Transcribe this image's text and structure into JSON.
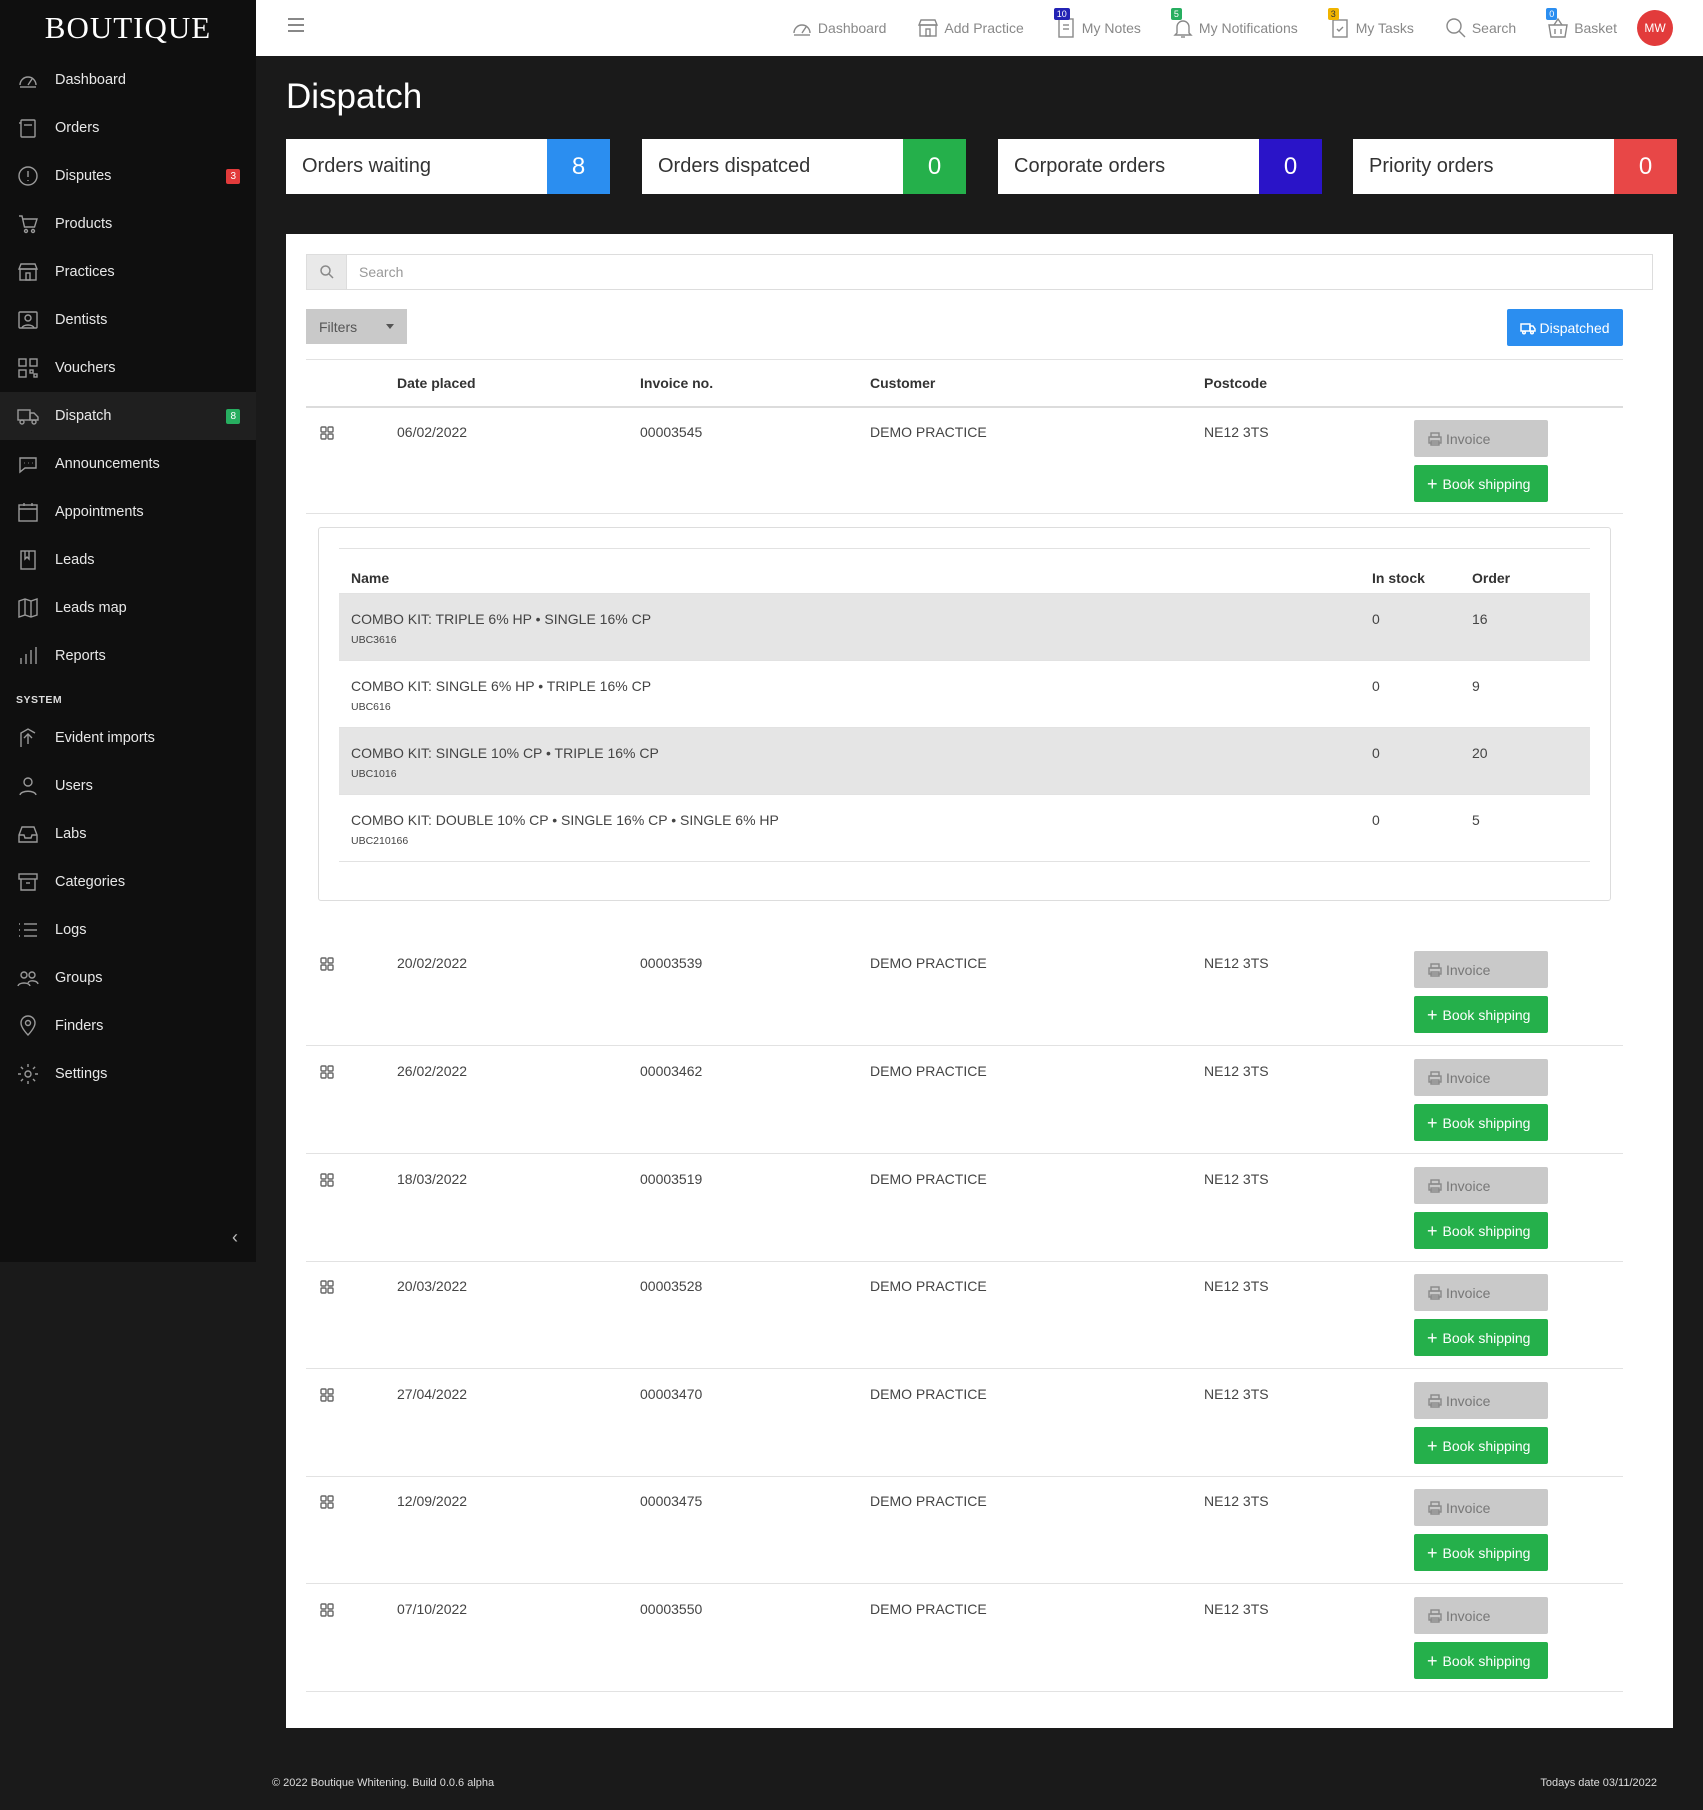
{
  "app": {
    "logo": "BOUTIQUE",
    "page_title": "Dispatch"
  },
  "sidebar": {
    "items": [
      {
        "label": "Dashboard",
        "icon": "dashboard-icon"
      },
      {
        "label": "Orders",
        "icon": "orders-icon"
      },
      {
        "label": "Disputes",
        "icon": "disputes-icon",
        "badge": "3"
      },
      {
        "label": "Products",
        "icon": "cart-icon"
      },
      {
        "label": "Practices",
        "icon": "store-icon"
      },
      {
        "label": "Dentists",
        "icon": "dentist-icon"
      },
      {
        "label": "Vouchers",
        "icon": "qr-icon"
      },
      {
        "label": "Dispatch",
        "icon": "truck-icon",
        "badge": "8",
        "active": true
      },
      {
        "label": "Announcements",
        "icon": "chat-icon"
      },
      {
        "label": "Appointments",
        "icon": "calendar-icon"
      },
      {
        "label": "Leads",
        "icon": "book-icon"
      },
      {
        "label": "Leads map",
        "icon": "map-icon"
      },
      {
        "label": "Reports",
        "icon": "bar-chart-icon"
      }
    ],
    "system_label": "SYSTEM",
    "system_items": [
      {
        "label": "Evident imports",
        "icon": "import-icon"
      },
      {
        "label": "Users",
        "icon": "user-icon"
      },
      {
        "label": "Labs",
        "icon": "inbox-icon"
      },
      {
        "label": "Categories",
        "icon": "archive-icon"
      },
      {
        "label": "Logs",
        "icon": "list-icon"
      },
      {
        "label": "Groups",
        "icon": "group-icon"
      },
      {
        "label": "Finders",
        "icon": "pin-icon"
      },
      {
        "label": "Settings",
        "icon": "gear-icon"
      }
    ]
  },
  "topbar": {
    "items": [
      {
        "label": "Dashboard",
        "icon": "dashboard-icon"
      },
      {
        "label": "Add Practice",
        "icon": "store-icon"
      },
      {
        "label": "My Notes",
        "icon": "notes-icon",
        "badge": "10",
        "badge_color": "#2323b5"
      },
      {
        "label": "My Notifications",
        "icon": "bell-icon",
        "badge": "5",
        "badge_color": "#27ae60"
      },
      {
        "label": "My Tasks",
        "icon": "tasks-icon",
        "badge": "3",
        "badge_color": "#f0b400"
      },
      {
        "label": "Search",
        "icon": "search-icon"
      },
      {
        "label": "Basket",
        "icon": "basket-icon",
        "badge": "0",
        "badge_color": "#2b8ef0"
      }
    ],
    "avatar": "MW"
  },
  "stats": [
    {
      "label": "Orders waiting",
      "value": "8",
      "color": "#2b8ef0"
    },
    {
      "label": "Orders dispatced",
      "value": "0",
      "color": "#25b04b"
    },
    {
      "label": "Corporate orders",
      "value": "0",
      "color": "#2a14c8"
    },
    {
      "label": "Priority orders",
      "value": "0",
      "color": "#e84747"
    }
  ],
  "search": {
    "placeholder": "Search",
    "value": ""
  },
  "filters_label": "Filters",
  "dispatched_label": "Dispatched",
  "table": {
    "headers": {
      "date": "Date placed",
      "invoice": "Invoice no.",
      "customer": "Customer",
      "postcode": "Postcode"
    },
    "invoice_label": "Invoice",
    "ship_label": "Book shipping",
    "rows": [
      {
        "date": "06/02/2022",
        "invoice": "00003545",
        "customer": "DEMO PRACTICE",
        "postcode": "NE12 3TS"
      },
      {
        "date": "20/02/2022",
        "invoice": "00003539",
        "customer": "DEMO PRACTICE",
        "postcode": "NE12 3TS"
      },
      {
        "date": "26/02/2022",
        "invoice": "00003462",
        "customer": "DEMO PRACTICE",
        "postcode": "NE12 3TS"
      },
      {
        "date": "18/03/2022",
        "invoice": "00003519",
        "customer": "DEMO PRACTICE",
        "postcode": "NE12 3TS"
      },
      {
        "date": "20/03/2022",
        "invoice": "00003528",
        "customer": "DEMO PRACTICE",
        "postcode": "NE12 3TS"
      },
      {
        "date": "27/04/2022",
        "invoice": "00003470",
        "customer": "DEMO PRACTICE",
        "postcode": "NE12 3TS"
      },
      {
        "date": "12/09/2022",
        "invoice": "00003475",
        "customer": "DEMO PRACTICE",
        "postcode": "NE12 3TS"
      },
      {
        "date": "07/10/2022",
        "invoice": "00003550",
        "customer": "DEMO PRACTICE",
        "postcode": "NE12 3TS"
      }
    ]
  },
  "expanded": {
    "headers": {
      "name": "Name",
      "in_stock": "In stock",
      "order": "Order"
    },
    "items": [
      {
        "name": "COMBO KIT: TRIPLE 6% HP • SINGLE 16% CP",
        "code": "UBC3616",
        "in_stock": "0",
        "order": "16"
      },
      {
        "name": "COMBO KIT: SINGLE 6% HP • TRIPLE 16% CP",
        "code": "UBC616",
        "in_stock": "0",
        "order": "9"
      },
      {
        "name": "COMBO KIT: SINGLE 10% CP • TRIPLE 16% CP",
        "code": "UBC1016",
        "in_stock": "0",
        "order": "20"
      },
      {
        "name": "COMBO KIT: DOUBLE 10% CP • SINGLE 16% CP • SINGLE 6% HP",
        "code": "UBC210166",
        "in_stock": "0",
        "order": "5"
      }
    ]
  },
  "footer": {
    "left": "© 2022 Boutique Whitening. Build 0.0.6 alpha",
    "right": "Todays date 03/11/2022"
  }
}
